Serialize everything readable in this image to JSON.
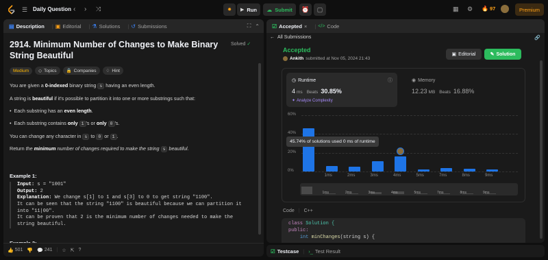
{
  "topbar": {
    "list_title": "Daily Question",
    "run_label": "Run",
    "submit_label": "Submit",
    "streak_count": "97",
    "premium_label": "Premium"
  },
  "left_tabs": [
    {
      "label": "Description"
    },
    {
      "label": "Editorial"
    },
    {
      "label": "Solutions"
    },
    {
      "label": "Submissions"
    }
  ],
  "problem": {
    "title_line1": "2914. Minimum Number of Changes to Make Binary",
    "title_line2": "String Beautiful",
    "solved": "Solved",
    "difficulty": "Medium",
    "tags": [
      "Topics",
      "Companies",
      "Hint"
    ],
    "p1_a": "You are given a ",
    "p1_b": "0-indexed",
    "p1_c": " binary string ",
    "p1_code": "s",
    "p1_d": " having an even length.",
    "p2_a": "A string is ",
    "p2_b": "beautiful",
    "p2_c": " if it's possible to partition it into one or more substrings such that:",
    "li1_a": "Each substring has an ",
    "li1_b": "even length",
    "li1_c": ".",
    "li2_a": "Each substring contains ",
    "li2_b": "only",
    "li2_code1": "1",
    "li2_c": "'s or ",
    "li2_d": "only",
    "li2_code2": "0",
    "li2_e": "'s.",
    "p3_a": "You can change any character in ",
    "p3_code1": "s",
    "p3_b": " to ",
    "p3_code2": "0",
    "p3_c": " or ",
    "p3_code3": "1",
    "p3_d": ".",
    "p4_a": "Return ",
    "p4_b": "the ",
    "p4_c": "minimum",
    "p4_d": " number of changes required to make the string ",
    "p4_code": "s",
    "p4_e": " beautiful.",
    "example1_title": "Example 1:",
    "ex_input_label": "Input:",
    "ex_input_value": " s = \"1001\"",
    "ex_output_label": "Output:",
    "ex_output_value": " 2",
    "ex_expl_label": "Explanation:",
    "ex_expl_1": " We change s[1] to 1 and s[3] to 0 to get string \"1100\".",
    "ex_expl_2": "It can be seen that the string \"1100\" is beautiful because we can partition it",
    "ex_expl_3": "into \"11|00\".",
    "ex_expl_4": "It can be proven that 2 is the minimum number of changes needed to make the",
    "ex_expl_5": "string beautiful.",
    "example2_title": "Example 2:"
  },
  "left_footer": {
    "likes": "501",
    "comments": "241"
  },
  "right_tabs": {
    "accepted": "Accepted",
    "code": "Code"
  },
  "submission": {
    "back_label": "All Submissions",
    "status": "Accepted",
    "user": "Ankith",
    "submitted": "submitted at Nov 05, 2024 21:43",
    "editorial_label": "Editorial",
    "solution_label": "Solution",
    "runtime_label": "Runtime",
    "runtime_value": "4",
    "runtime_unit": "ms",
    "runtime_beats_label": "Beats",
    "runtime_beats": "30.85%",
    "analyze_label": "Analyze Complexity",
    "memory_label": "Memory",
    "memory_value": "12.23",
    "memory_unit": "MB",
    "memory_beats_label": "Beats",
    "memory_beats": "16.88%",
    "tooltip": "45.74% of solutions used 0 ms of runtime",
    "code_lang_label": "Code",
    "code_lang": "C++",
    "code_line1_kw": "class",
    "code_line1_name": " Solution {",
    "code_line2": "public:",
    "code_line3_type": "int",
    "code_line3_fn": " minChanges",
    "code_line3_rest": "(string s) {"
  },
  "bottom_tabs": {
    "testcase": "Testcase",
    "test_result": "Test Result"
  },
  "chart_data": {
    "type": "bar",
    "y_tick_labels": [
      "60%",
      "40%",
      "20%",
      "0%"
    ],
    "ylim": [
      0,
      60
    ],
    "x_tick_labels": [
      "1ms",
      "2ms",
      "3ms",
      "4ms",
      "5ms",
      "7ms",
      "8ms",
      "9ms"
    ],
    "values": [
      45.74,
      6,
      5,
      11,
      16,
      2,
      4,
      3,
      2
    ],
    "user_bar_index": 4,
    "bar_color": "#1e74e6"
  },
  "colors": {
    "accent_green": "#2cbb5d",
    "accent_orange": "#ffa116",
    "bar_blue": "#1e74e6"
  }
}
